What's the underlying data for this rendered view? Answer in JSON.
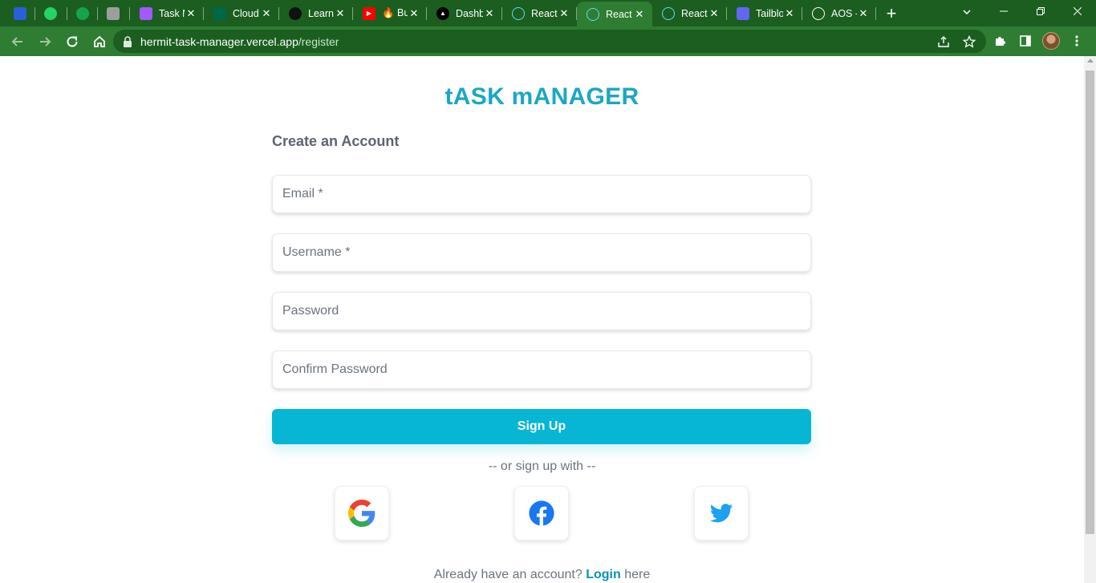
{
  "browser": {
    "tabs": [
      {
        "title": "",
        "pinned": true,
        "favicon": "blue-app-icon",
        "color": "#2b5fd9"
      },
      {
        "title": "",
        "pinned": true,
        "favicon": "whatsapp-icon",
        "color": "#25d366"
      },
      {
        "title": "",
        "pinned": true,
        "favicon": "green-circle-icon",
        "color": "#16a34a"
      },
      {
        "title": "",
        "pinned": true,
        "favicon": "list-icon",
        "color": "#9e9e9e"
      },
      {
        "title": "Task M",
        "favicon": "figma-icon",
        "color": "#a259ff"
      },
      {
        "title": "Cloud",
        "favicon": "mongodb-leaf-icon",
        "color": "#00684a"
      },
      {
        "title": "Learn",
        "favicon": "dark-circle-icon",
        "color": "#111111"
      },
      {
        "title": "🔥 Bu",
        "favicon": "youtube-icon",
        "color": "#ff0000"
      },
      {
        "title": "Dashb",
        "favicon": "vercel-triangle-icon",
        "color": "#000000"
      },
      {
        "title": "React",
        "favicon": "react-icon",
        "color": "#61dafb"
      },
      {
        "title": "React",
        "favicon": "react-icon",
        "color": "#61dafb",
        "active": true
      },
      {
        "title": "React",
        "favicon": "react-icon",
        "color": "#61dafb"
      },
      {
        "title": "Tailblo",
        "favicon": "tailblocks-icon",
        "color": "#6366f1"
      },
      {
        "title": "AOS -",
        "favicon": "globe-icon",
        "color": "#ffffff"
      }
    ],
    "url_host": "hermit-task-manager.vercel.app",
    "url_path": "/register"
  },
  "page": {
    "app_title": "tASK mANAGER",
    "form_heading": "Create an Account",
    "fields": {
      "email_placeholder": "Email *",
      "username_placeholder": "Username *",
      "password_placeholder": "Password",
      "confirm_placeholder": "Confirm Password"
    },
    "signup_label": "Sign Up",
    "divider_text": "-- or sign up with --",
    "social": [
      "google",
      "facebook",
      "twitter"
    ],
    "login_prefix": "Already have an account?",
    "login_link": "Login",
    "login_suffix": "here"
  },
  "colors": {
    "brand": "#1aa7c4",
    "button": "#06b6d4",
    "chrome_dark": "#1b5e20",
    "chrome": "#2e7d32"
  }
}
